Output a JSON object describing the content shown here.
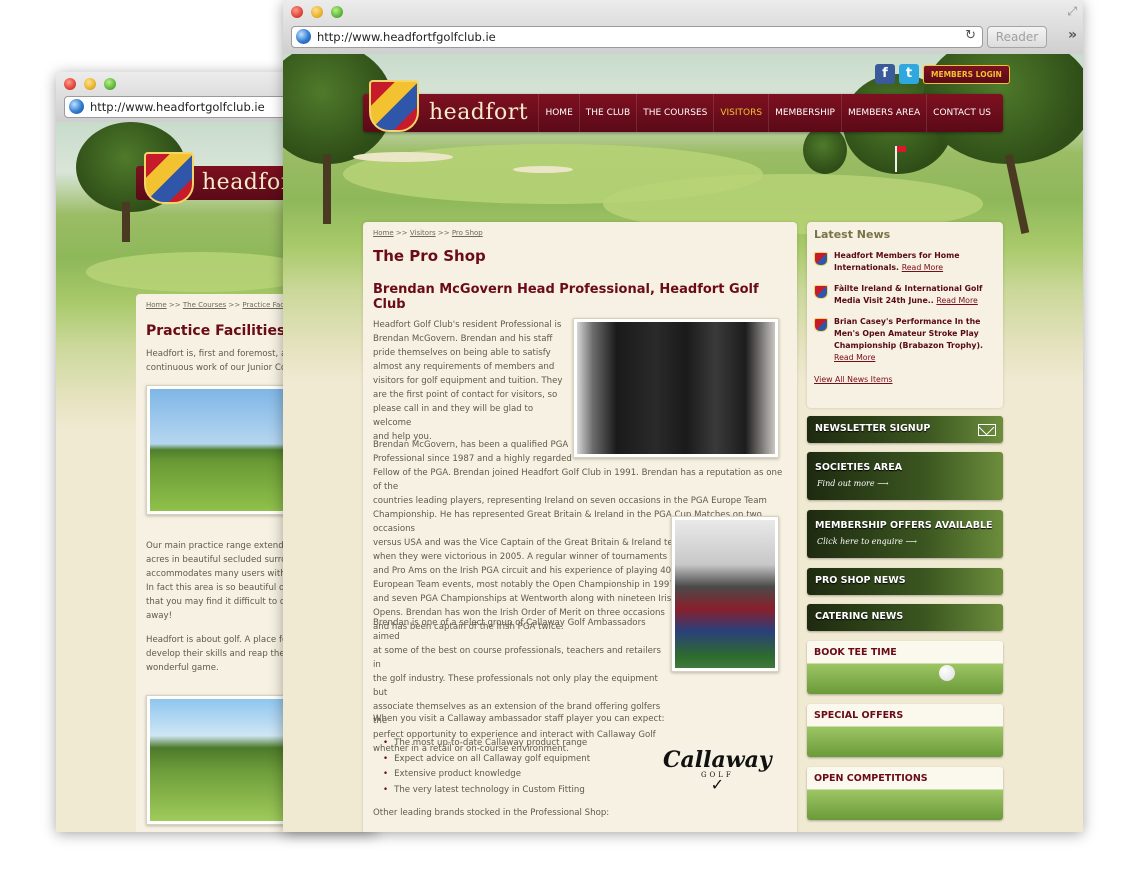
{
  "back_window": {
    "url": "http://www.headfortgolfclub.ie",
    "logo": "headfort",
    "breadcrumb": {
      "home": "Home",
      "sep": ">>",
      "section": "The Courses",
      "current": "Practice Faciliti"
    },
    "title": "Practice Facilities",
    "intro_lines": [
      "Headfort is, first and foremost, a g",
      "continuous work of our Junior Co"
    ],
    "para2_lines": [
      "Our main practice range extends o",
      "acres in beautiful secluded surrou",
      "accommodates many users witho",
      "In fact this area is so beautiful on",
      "that you may find it difficult to dra",
      "away!"
    ],
    "para3_lines": [
      "Headfort is about golf. A place for",
      "develop their skills and reap the b",
      "wonderful game."
    ]
  },
  "front_window": {
    "url": "http://www.headfortfgolfclub.ie",
    "reader_label": "Reader",
    "header": {
      "logo": "headfort",
      "members_login": "MEMBERS LOGIN",
      "facebook": "f",
      "twitter": "t",
      "nav": [
        "HOME",
        "THE CLUB",
        "THE COURSES",
        "VISITORS",
        "MEMBERSHIP",
        "MEMBERS AREA",
        "CONTACT US"
      ],
      "active_nav": "VISITORS"
    },
    "breadcrumb": {
      "home": "Home",
      "sep": ">>",
      "section": "Visitors",
      "current": "Pro Shop"
    },
    "page_title": "The Pro Shop",
    "subtitle": "Brendan McGovern Head Professional, Headfort Golf Club",
    "para1_lines": [
      "Headfort Golf Club's resident Professional is",
      "Brendan McGovern. Brendan and his staff",
      "pride themselves on being able to satisfy",
      "almost any requirements of members and",
      "visitors for golf equipment and tuition. They",
      "are the first point of contact for visitors, so",
      "please call in and they will be glad to welcome",
      "and help you."
    ],
    "para2_lines": [
      "Brendan McGovern, has been a qualified PGA",
      "Professional since 1987 and a highly regarded",
      "Fellow of the PGA. Brendan joined Headfort Golf Club in 1991. Brendan has a reputation as one of the",
      "countries leading players, representing Ireland on seven occasions in the PGA Europe Team",
      "Championship. He has represented Great Britain & Ireland in the PGA Cup Matches on two occasions",
      "versus USA and was the Vice Captain of the Great Britain & Ireland team",
      "when they were victorious in 2005. A regular winner of tournaments",
      "and Pro Ams on the Irish PGA circuit and his experience of playing 40",
      "European Team events, most notably the Open Championship in 1997",
      "and seven PGA Championships at Wentworth along with nineteen Irish",
      "Opens. Brendan has won the Irish Order of Merit on three occasions",
      "and has been captain of the Irish PGA twice."
    ],
    "para3_lines": [
      "Brendan is one of a select group of Callaway Golf Ambassadors aimed",
      "at some of the best on course professionals, teachers and retailers in",
      "the golf industry. These professionals not only play the equipment but",
      "associate themselves as an extension of the brand offering golfers the",
      "perfect opportunity to experience and interact with Callaway Golf",
      "whether in a retail or on-course environment."
    ],
    "expect_intro": "When you visit a Callaway ambassador staff player you can expect:",
    "bullets": [
      "The most up-to-date Callaway product range",
      "Expect advice on all Callaway golf equipment",
      "Extensive product knowledge",
      "The very latest technology in Custom Fitting"
    ],
    "other_brands": "Other leading brands stocked in the Professional Shop:",
    "callaway": {
      "name": "Callaway",
      "sub": "GOLF"
    },
    "news": {
      "heading": "Latest News",
      "items": [
        {
          "text": "Headfort Members for Home Internationals.",
          "more": "Read More"
        },
        {
          "text": "Fàilte Ireland & International Golf Media Visit 24th June..",
          "more": "Read More"
        },
        {
          "text": "Brian Casey's Performance In the Men's Open Amateur Stroke Play Championship (Brabazon Trophy).",
          "more": "Read More"
        }
      ],
      "view_all": "View All News Items"
    },
    "banners": {
      "newsletter": "NEWSLETTER SIGNUP",
      "societies": "SOCIETIES AREA",
      "societies_sub": "Find out more",
      "membership": "MEMBERSHIP OFFERS AVAILABLE",
      "membership_sub": "Click here to enquire",
      "proshop": "PRO SHOP NEWS",
      "catering": "CATERING NEWS",
      "tee_time": "BOOK TEE TIME",
      "special": "SPECIAL OFFERS",
      "competitions": "OPEN COMPETITIONS"
    }
  }
}
